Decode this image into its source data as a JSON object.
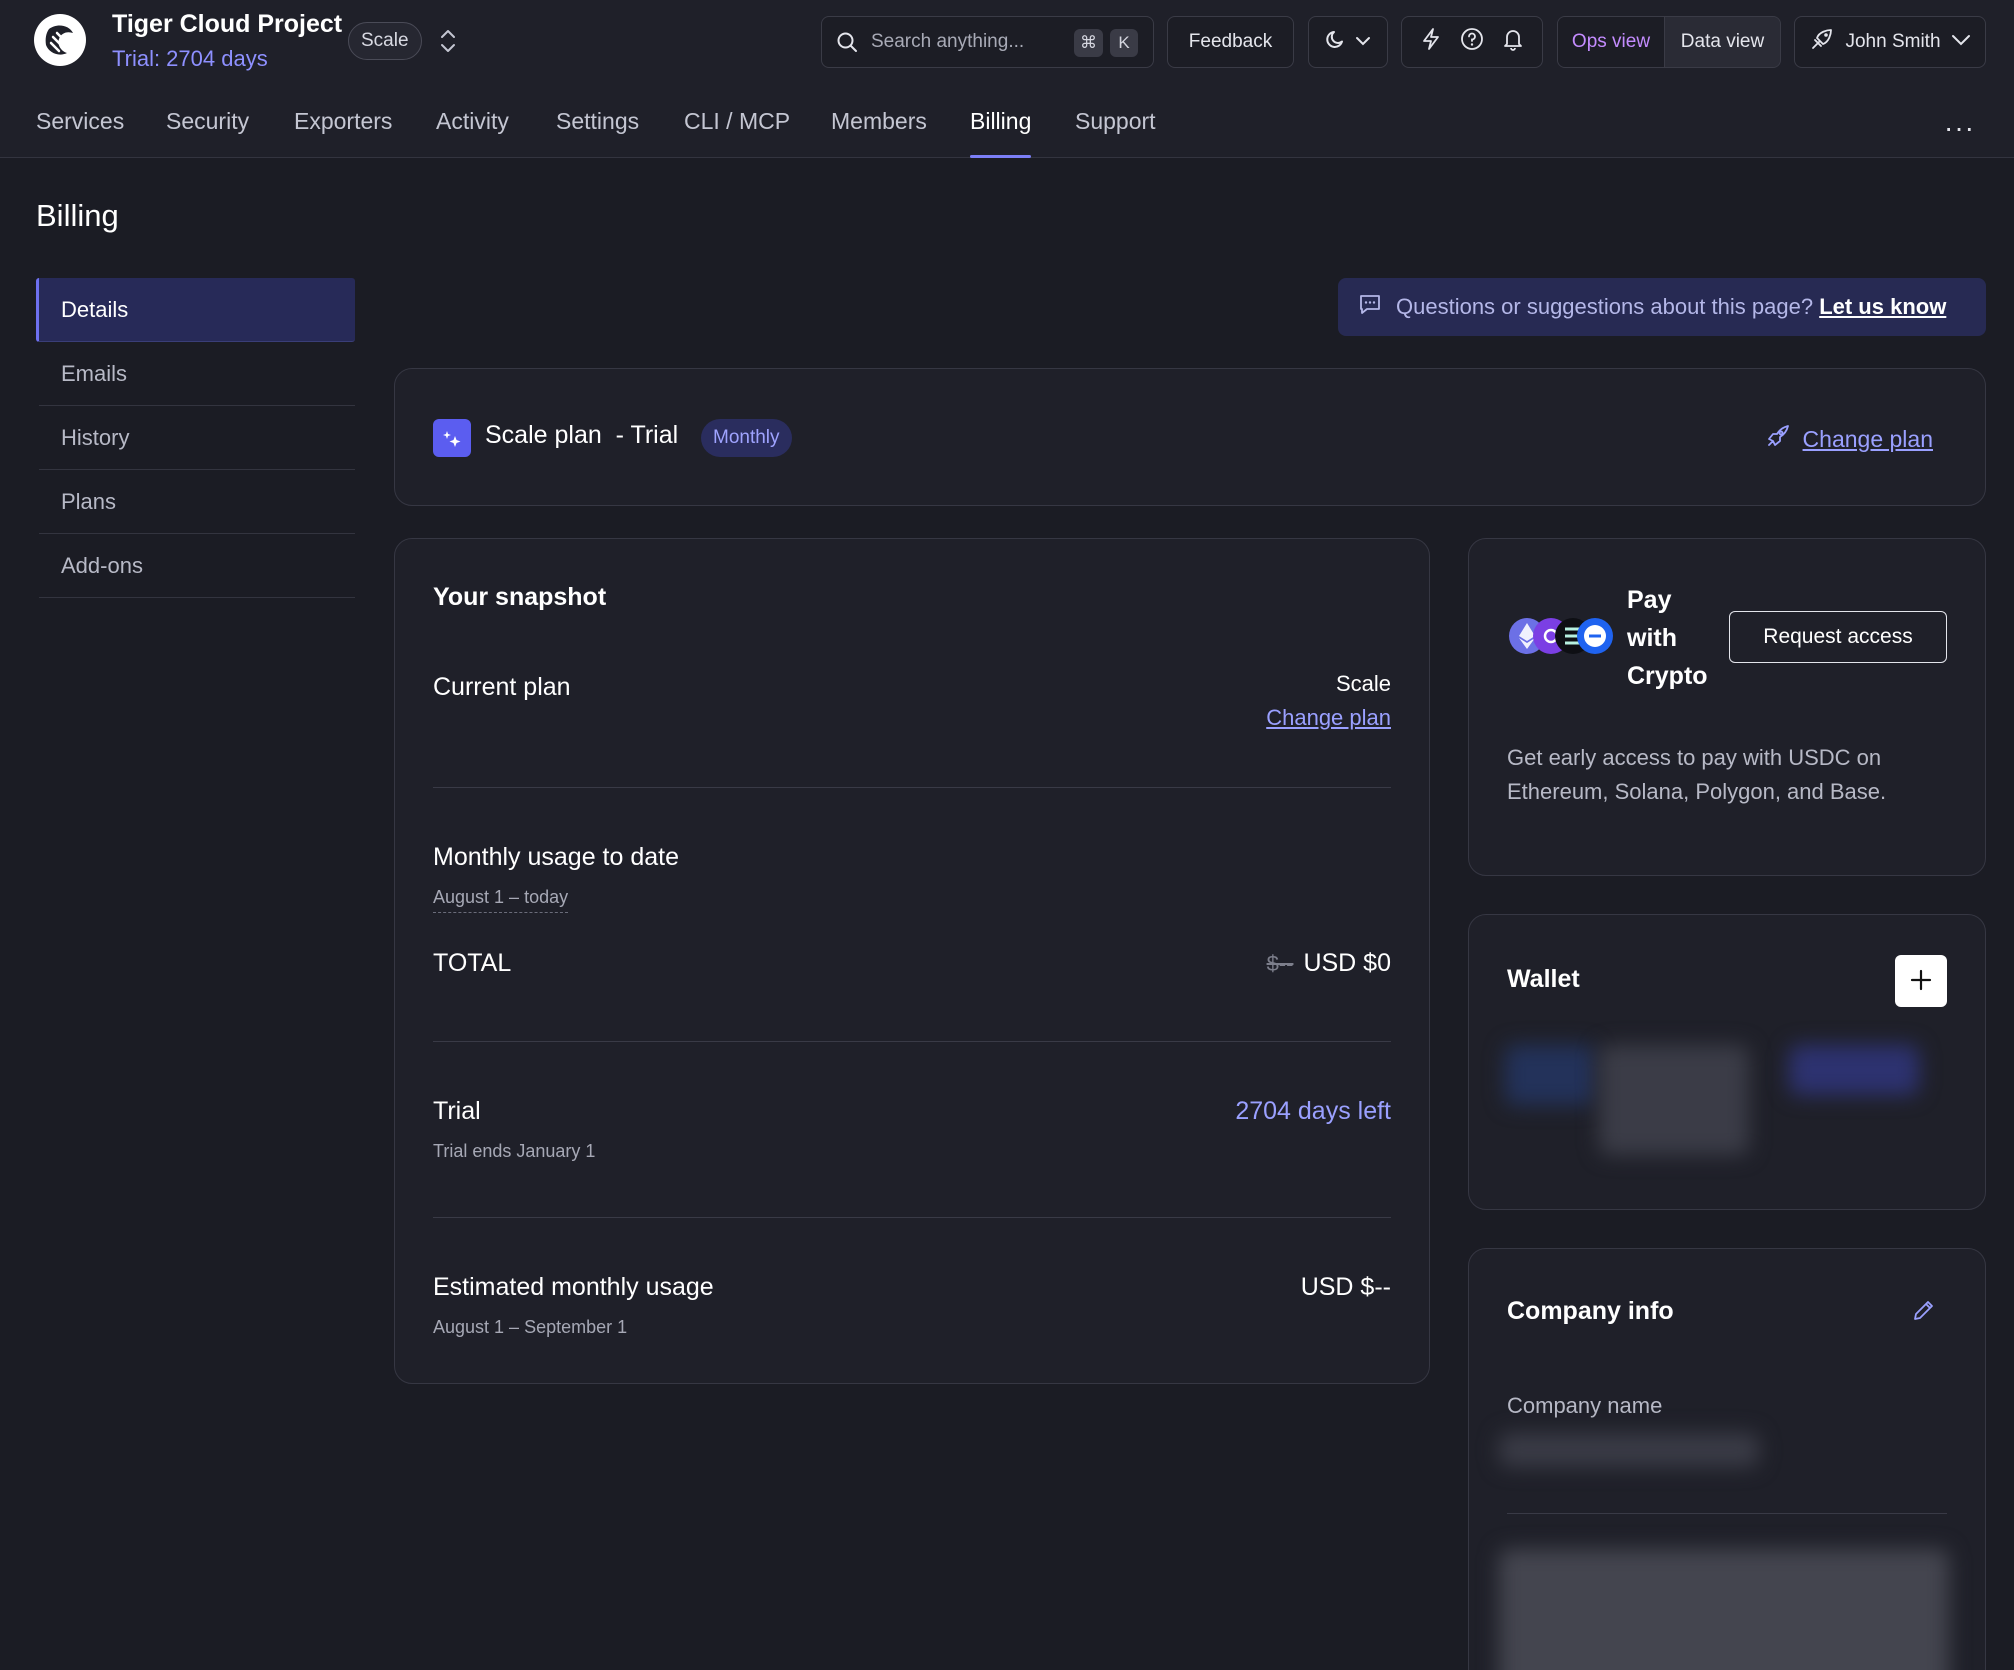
{
  "header": {
    "project_name": "Tiger Cloud Project",
    "trial_label": "Trial: 2704 days",
    "plan_pill": "Scale",
    "search_placeholder": "Search anything...",
    "shortcut_keys": [
      "⌘",
      "K"
    ],
    "feedback_label": "Feedback",
    "view_ops": "Ops view",
    "view_data": "Data view",
    "user_name": "John Smith"
  },
  "nav": {
    "items": [
      "Services",
      "Security",
      "Exporters",
      "Activity",
      "Settings",
      "CLI / MCP",
      "Members",
      "Billing",
      "Support"
    ],
    "active": "Billing",
    "more": "···"
  },
  "page": {
    "title": "Billing",
    "side": [
      "Details",
      "Emails",
      "History",
      "Plans",
      "Add-ons"
    ],
    "side_active": "Details",
    "banner_text": "Questions or suggestions about this page?",
    "banner_link": "Let us know"
  },
  "plan_card": {
    "name": "Scale plan",
    "suffix": "- Trial",
    "badge": "Monthly",
    "change_plan": "Change plan"
  },
  "snapshot": {
    "title": "Your snapshot",
    "current_plan_label": "Current plan",
    "current_plan_value": "Scale",
    "change_plan": "Change plan",
    "monthly_usage_label": "Monthly usage to date",
    "monthly_usage_range": "August 1 – today",
    "total_label": "TOTAL",
    "total_strike": "$--",
    "total_value": "USD $0",
    "trial_label": "Trial",
    "trial_ends": "Trial ends January 1",
    "trial_days_left": "2704 days left",
    "estimated_label": "Estimated monthly usage",
    "estimated_range": "August 1 – September 1",
    "estimated_value": "USD $--"
  },
  "crypto": {
    "title_line1": "Pay",
    "title_line2": "with",
    "title_line3": "Crypto",
    "button": "Request access",
    "description": "Get early access to pay with USDC on Ethereum, Solana, Polygon, and Base."
  },
  "wallet": {
    "title": "Wallet"
  },
  "company": {
    "title": "Company info",
    "name_label": "Company name"
  },
  "colors": {
    "accent": "#7c7ff7",
    "background": "#1b1c24",
    "card": "#1f2029",
    "link": "#9aa0ff"
  }
}
